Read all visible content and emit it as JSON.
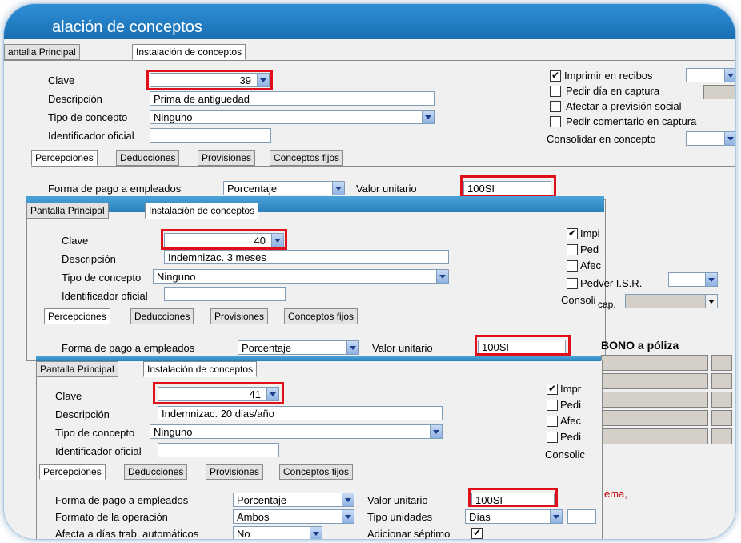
{
  "window_title": "alación de conceptos",
  "tabs": [
    "Pantalla Principal",
    "Instalación de conceptos"
  ],
  "tab_prefix_cropped": "antalla Principal",
  "subtabs": [
    "Percepciones",
    "Deducciones",
    "Provisiones",
    "Conceptos fijos"
  ],
  "labels": {
    "clave": "Clave",
    "descripcion": "Descripción",
    "tipo": "Tipo de concepto",
    "identificador": "Identificador oficial",
    "forma_pago": "Forma de pago a empleados",
    "valor_unitario": "Valor unitario",
    "formato_operacion": "Formato de la operación",
    "tipo_unidades": "Tipo unidades",
    "afecta_dias": "Afecta a días trab. automáticos",
    "adicionar_septimo": "Adicionar séptimo"
  },
  "panel1": {
    "clave": "39",
    "descripcion": "Prima de antiguedad",
    "tipo": "Ninguno",
    "identificador": "",
    "forma_pago": "Porcentaje",
    "valor_unitario": "100SI",
    "options": {
      "imprimir": "Imprimir en recibos",
      "pedir_dia": "Pedir día en captura",
      "afectar": "Afectar a previsión social",
      "comentario": "Pedir comentario en captura",
      "consolidar": "Consolidar en concepto"
    }
  },
  "panel2": {
    "clave": "40",
    "descripcion": "Indemnizac. 3 meses",
    "tipo": "Ninguno",
    "identificador": "",
    "forma_pago": "Porcentaje",
    "valor_unitario": "100SI",
    "options": {
      "imp": "Impi",
      "ped": "Ped",
      "afec": "Afec",
      "pedver": "Pedver I.S.R.",
      "consoli": "Consoli",
      "cap": "cap."
    },
    "bono": "BONO a póliza"
  },
  "panel3": {
    "clave": "41",
    "descripcion": "Indemnizac. 20 dias/año",
    "tipo": "Ninguno",
    "identificador": "",
    "forma_pago": "Porcentaje",
    "valor_unitario": "100SI",
    "formato_operacion": "Ambos",
    "tipo_unidades": "Días",
    "afecta_dias": "No",
    "adicionar_septimo": true,
    "options": {
      "imp": "Impr",
      "pedi": "Pedi",
      "afec": "Afec",
      "pedi2": "Pedi",
      "consolic": "Consolic"
    },
    "ema_text": "ema,"
  },
  "colors": {
    "title_blue": "#1a6fb4",
    "highlight_red": "#e0101a",
    "dropdown_blue": "#8fb2e4"
  }
}
